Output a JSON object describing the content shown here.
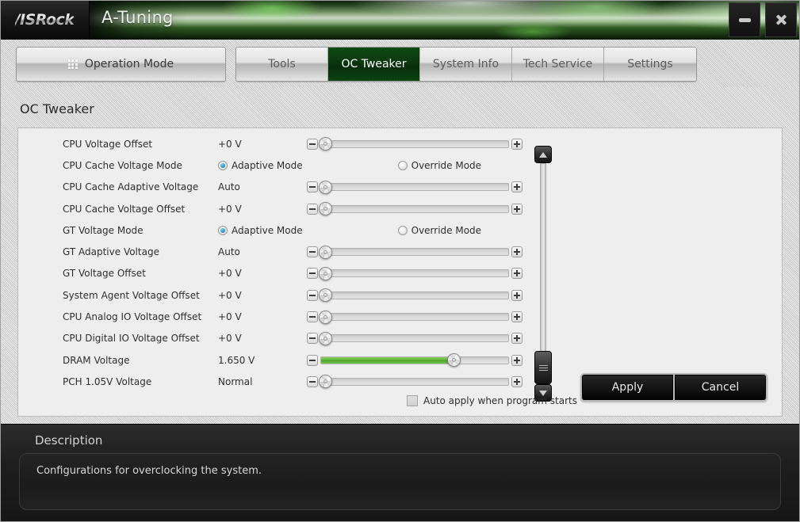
{
  "window": {
    "brand": "/ISRock",
    "title": "A-Tuning",
    "minimize_label": "–",
    "close_label": "✕"
  },
  "nav": {
    "operation_mode": "Operation Mode",
    "tabs": [
      {
        "label": "Tools",
        "active": false
      },
      {
        "label": "OC Tweaker",
        "active": true
      },
      {
        "label": "System Info",
        "active": false
      },
      {
        "label": "Tech Service",
        "active": false
      },
      {
        "label": "Settings",
        "active": false
      }
    ]
  },
  "page": {
    "section_title": "OC Tweaker"
  },
  "settings": {
    "rows": [
      {
        "label": "CPU Voltage Offset",
        "value": "+0 V",
        "control": "slider",
        "fill_pct": 0,
        "knob_pct": 0
      },
      {
        "label": "CPU Cache Voltage Mode",
        "control": "radio",
        "options": [
          "Adaptive Mode",
          "Override Mode"
        ],
        "selected": 0
      },
      {
        "label": "CPU Cache Adaptive Voltage",
        "value": "Auto",
        "control": "slider",
        "fill_pct": 0,
        "knob_pct": 0
      },
      {
        "label": "CPU Cache Voltage Offset",
        "value": "+0 V",
        "control": "slider",
        "fill_pct": 0,
        "knob_pct": 0
      },
      {
        "label": "GT Voltage Mode",
        "control": "radio",
        "options": [
          "Adaptive Mode",
          "Override Mode"
        ],
        "selected": 0
      },
      {
        "label": "GT Adaptive Voltage",
        "value": "Auto",
        "control": "slider",
        "fill_pct": 0,
        "knob_pct": 0
      },
      {
        "label": "GT Voltage Offset",
        "value": "+0 V",
        "control": "slider",
        "fill_pct": 0,
        "knob_pct": 0
      },
      {
        "label": "System Agent Voltage Offset",
        "value": "+0 V",
        "control": "slider",
        "fill_pct": 0,
        "knob_pct": 0
      },
      {
        "label": "CPU Analog IO Voltage Offset",
        "value": "+0 V",
        "control": "slider",
        "fill_pct": 0,
        "knob_pct": 0
      },
      {
        "label": "CPU Digital IO Voltage Offset",
        "value": "+0 V",
        "control": "slider",
        "fill_pct": 0,
        "knob_pct": 0
      },
      {
        "label": "DRAM Voltage",
        "value": "1.650 V",
        "control": "slider",
        "fill_pct": 71,
        "knob_pct": 71
      },
      {
        "label": "PCH 1.05V Voltage",
        "value": "Normal",
        "control": "slider",
        "fill_pct": 0,
        "knob_pct": 0
      }
    ]
  },
  "footer": {
    "auto_apply_label": "Auto apply when program starts",
    "auto_apply_checked": false,
    "apply_label": "Apply",
    "cancel_label": "Cancel"
  },
  "description": {
    "title": "Description",
    "text": "Configurations for overclocking the system."
  },
  "colors": {
    "accent_green": "#0a3a0e",
    "slider_fill": "#5ab534",
    "radio_selected": "#1f84ad",
    "panel_bg": "#eeeeee",
    "desc_bg": "#1b1b1b"
  }
}
